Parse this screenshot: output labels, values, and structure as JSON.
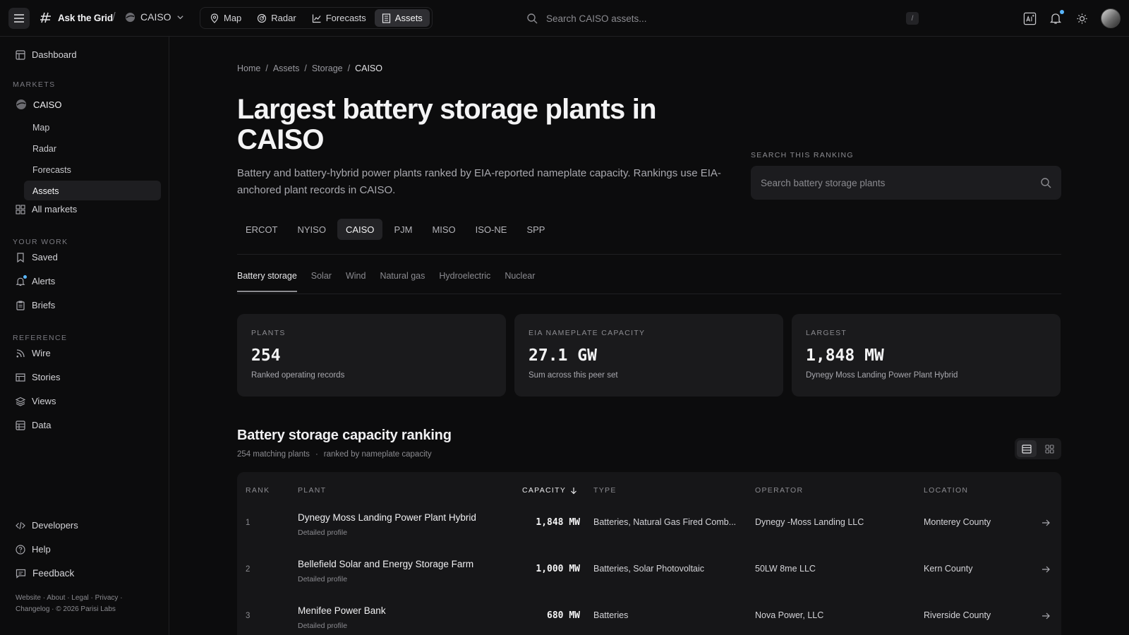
{
  "topbar": {
    "app_name": "Ask the Grid",
    "market": "CAISO",
    "nav_tabs": [
      {
        "label": "Map"
      },
      {
        "label": "Radar"
      },
      {
        "label": "Forecasts"
      },
      {
        "label": "Assets"
      }
    ],
    "search_placeholder": "Search CAISO assets...",
    "search_shortcut": "/",
    "notification_dot_color": "#5ab7ff"
  },
  "sidebar": {
    "dashboard": "Dashboard",
    "markets_heading": "MARKETS",
    "market_name": "CAISO",
    "market_subitems": [
      "Map",
      "Radar",
      "Forecasts",
      "Assets"
    ],
    "all_markets": "All markets",
    "your_work_heading": "YOUR WORK",
    "work_items": [
      "Saved",
      "Alerts",
      "Briefs"
    ],
    "reference_heading": "REFERENCE",
    "reference_items": [
      "Wire",
      "Stories",
      "Views",
      "Data"
    ],
    "developers": "Developers",
    "help": "Help",
    "feedback": "Feedback",
    "footer_line1": "Website · About · Legal · Privacy ·",
    "footer_line2": "Changelog · © 2026 Parisi Labs"
  },
  "breadcrumb": [
    "Home",
    "Assets",
    "Storage",
    "CAISO"
  ],
  "page": {
    "title": "Largest battery storage plants in CAISO",
    "description": "Battery and battery-hybrid power plants ranked by EIA-reported nameplate capacity. Rankings use EIA-anchored plant records in CAISO.",
    "search_label": "SEARCH THIS RANKING",
    "search_placeholder": "Search battery storage plants"
  },
  "market_tabs": [
    "ERCOT",
    "NYISO",
    "CAISO",
    "PJM",
    "MISO",
    "ISO-NE",
    "SPP"
  ],
  "type_tabs": [
    "Battery storage",
    "Solar",
    "Wind",
    "Natural gas",
    "Hydroelectric",
    "Nuclear"
  ],
  "stats": [
    {
      "label": "PLANTS",
      "value": "254",
      "sub": "Ranked operating records"
    },
    {
      "label": "EIA NAMEPLATE CAPACITY",
      "value": "27.1 GW",
      "sub": "Sum across this peer set"
    },
    {
      "label": "LARGEST",
      "value": "1,848 MW",
      "sub": "Dynegy Moss Landing Power Plant Hybrid"
    }
  ],
  "ranking": {
    "title": "Battery storage capacity ranking",
    "count": "254 matching plants",
    "separator": "·",
    "sort_note": "ranked by nameplate capacity",
    "columns": [
      "RANK",
      "PLANT",
      "CAPACITY",
      "TYPE",
      "OPERATOR",
      "LOCATION"
    ],
    "rows": [
      {
        "rank": "1",
        "plant": "Dynegy Moss Landing Power Plant Hybrid",
        "profile": "Detailed profile",
        "capacity": "1,848 MW",
        "type": "Batteries, Natural Gas Fired Comb...",
        "operator": "Dynegy -Moss Landing LLC",
        "location": "Monterey County"
      },
      {
        "rank": "2",
        "plant": "Bellefield Solar and Energy Storage Farm",
        "profile": "Detailed profile",
        "capacity": "1,000 MW",
        "type": "Batteries, Solar Photovoltaic",
        "operator": "50LW 8me LLC",
        "location": "Kern County"
      },
      {
        "rank": "3",
        "plant": "Menifee Power Bank",
        "profile": "Detailed profile",
        "capacity": "680 MW",
        "type": "Batteries",
        "operator": "Nova Power, LLC",
        "location": "Riverside County"
      }
    ]
  }
}
